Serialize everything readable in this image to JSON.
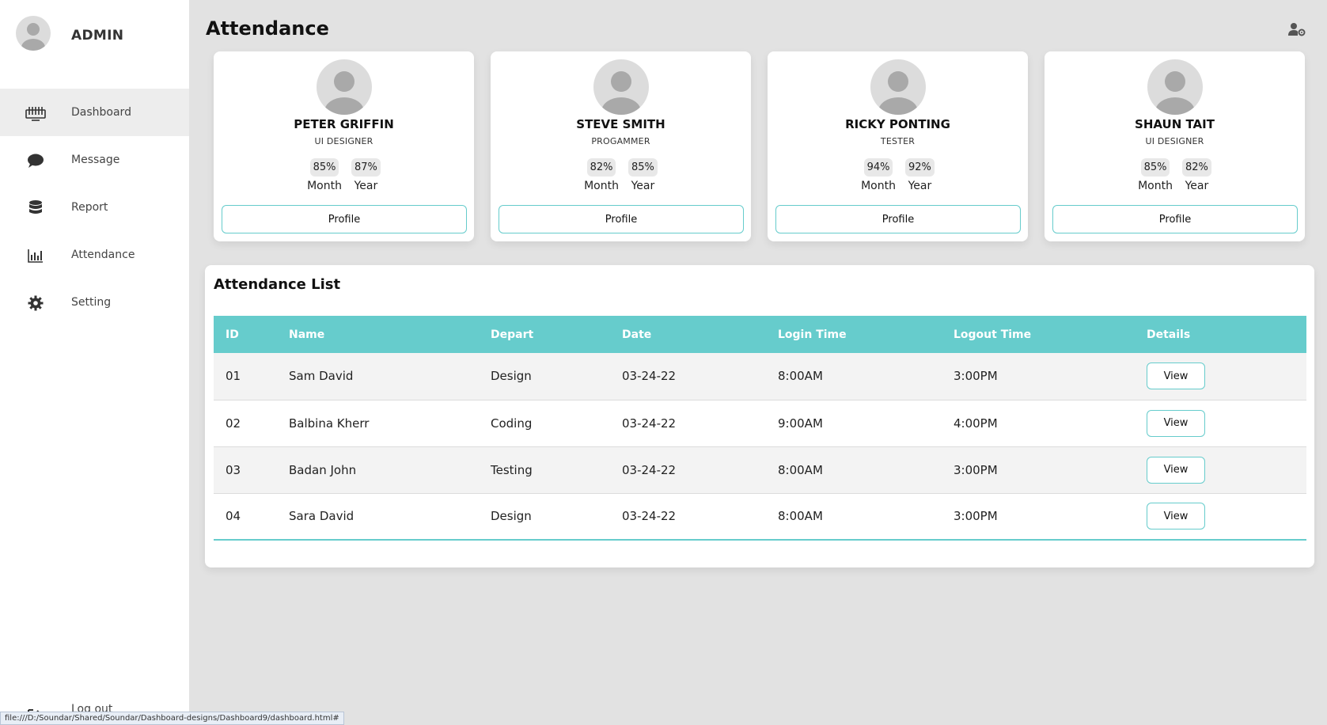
{
  "sidebar": {
    "brand": "ADMIN",
    "items": [
      {
        "label": "Dashboard",
        "icon": "keyboard-icon"
      },
      {
        "label": "Message",
        "icon": "chat-bubble-icon"
      },
      {
        "label": "Report",
        "icon": "database-icon"
      },
      {
        "label": "Attendance",
        "icon": "bar-chart-icon"
      },
      {
        "label": "Setting",
        "icon": "gear-icon"
      }
    ],
    "logout": "Log out"
  },
  "header": {
    "title": "Attendance",
    "user_icon": "user-gear-icon"
  },
  "cards": [
    {
      "name": "PETER GRIFFIN",
      "role": "UI DESIGNER",
      "month": "85%",
      "year": "87%",
      "month_label": "Month",
      "year_label": "Year",
      "button": "Profile"
    },
    {
      "name": "STEVE SMITH",
      "role": "PROGAMMER",
      "month": "82%",
      "year": "85%",
      "month_label": "Month",
      "year_label": "Year",
      "button": "Profile"
    },
    {
      "name": "RICKY PONTING",
      "role": "TESTER",
      "month": "94%",
      "year": "92%",
      "month_label": "Month",
      "year_label": "Year",
      "button": "Profile"
    },
    {
      "name": "SHAUN TAIT",
      "role": "UI DESIGNER",
      "month": "85%",
      "year": "82%",
      "month_label": "Month",
      "year_label": "Year",
      "button": "Profile"
    }
  ],
  "attendance_list": {
    "title": "Attendance List",
    "columns": [
      "ID",
      "Name",
      "Depart",
      "Date",
      "Login Time",
      "Logout Time",
      "Details"
    ],
    "rows": [
      {
        "id": "01",
        "name": "Sam David",
        "depart": "Design",
        "date": "03-24-22",
        "login": "8:00AM",
        "logout": "3:00PM",
        "details": "View"
      },
      {
        "id": "02",
        "name": "Balbina Kherr",
        "depart": "Coding",
        "date": "03-24-22",
        "login": "9:00AM",
        "logout": "4:00PM",
        "details": "View"
      },
      {
        "id": "03",
        "name": "Badan John",
        "depart": "Testing",
        "date": "03-24-22",
        "login": "8:00AM",
        "logout": "3:00PM",
        "details": "View"
      },
      {
        "id": "04",
        "name": "Sara David",
        "depart": "Design",
        "date": "03-24-22",
        "login": "8:00AM",
        "logout": "3:00PM",
        "details": "View"
      }
    ]
  },
  "status_bar": "file:///D:/Soundar/Shared/Soundar/Dashboard-designs/Dashboard9/dashboard.html#",
  "colors": {
    "accent": "#66cccc",
    "background": "#e2e2e2",
    "card": "#ffffff"
  }
}
